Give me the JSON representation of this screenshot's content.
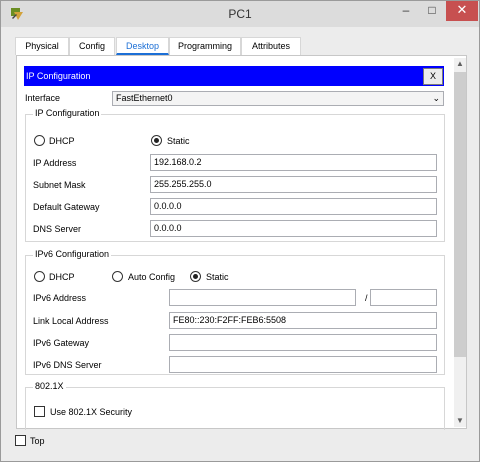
{
  "window": {
    "title": "PC1",
    "minimize": "–",
    "maximize": "□",
    "close": "✕"
  },
  "tabs": [
    {
      "label": "Physical"
    },
    {
      "label": "Config"
    },
    {
      "label": "Desktop"
    },
    {
      "label": "Programming"
    },
    {
      "label": "Attributes"
    }
  ],
  "active_tab": "Desktop",
  "header": {
    "title": "IP Configuration",
    "close_label": "X"
  },
  "interface": {
    "label": "Interface",
    "value": "FastEthernet0"
  },
  "ipv4": {
    "group_title": "IP Configuration",
    "dhcp_label": "DHCP",
    "static_label": "Static",
    "selected": "Static",
    "ip_label": "IP Address",
    "ip_value": "192.168.0.2",
    "mask_label": "Subnet Mask",
    "mask_value": "255.255.255.0",
    "gw_label": "Default Gateway",
    "gw_value": "0.0.0.0",
    "dns_label": "DNS Server",
    "dns_value": "0.0.0.0"
  },
  "ipv6": {
    "group_title": "IPv6 Configuration",
    "dhcp_label": "DHCP",
    "auto_label": "Auto Config",
    "static_label": "Static",
    "selected": "Static",
    "addr_label": "IPv6 Address",
    "addr_value": "",
    "prefix_sep": "/",
    "prefix_value": "",
    "link_label": "Link Local Address",
    "link_value": "FE80::230:F2FF:FEB6:5508",
    "gw_label": "IPv6 Gateway",
    "gw_value": "",
    "dns_label": "IPv6 DNS Server",
    "dns_value": ""
  },
  "dot1x": {
    "group_title": "802.1X",
    "use_label": "Use 802.1X Security",
    "checked": false
  },
  "footer": {
    "top_label": "Top",
    "checked": false
  }
}
